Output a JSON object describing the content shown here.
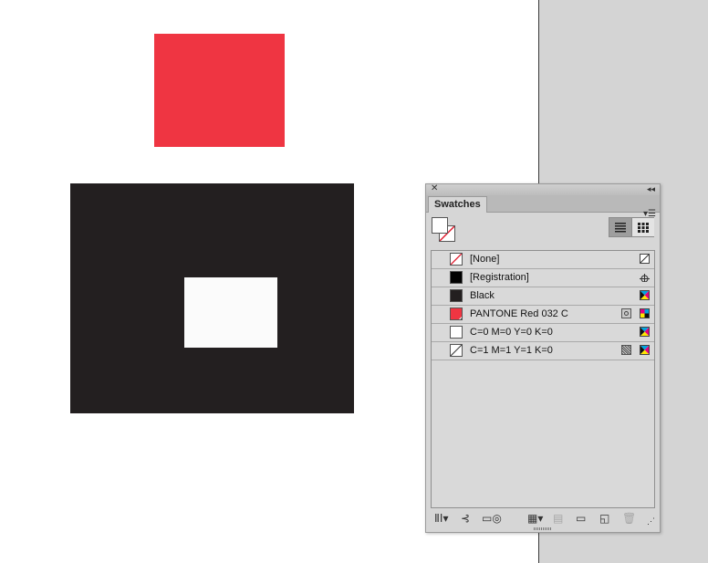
{
  "canvas": {
    "red_color": "#ef3542",
    "black_color": "#231f20",
    "white_color": "#fbfbfb"
  },
  "panel": {
    "close_icon": "close-icon",
    "collapse_icon": "double-chevron-left-icon",
    "tab_label": "Swatches",
    "menu_icon": "panel-menu-icon",
    "view_list_icon": "list-view-icon",
    "view_grid_icon": "grid-view-icon",
    "swatches": [
      {
        "name": "[None]",
        "color": "none",
        "mode_icon": "none-icon"
      },
      {
        "name": "[Registration]",
        "color": "#000000",
        "mode_icon": "registration-icon"
      },
      {
        "name": "Black",
        "color": "#231f20",
        "mode_icon": "cmyk-icon"
      },
      {
        "name": "PANTONE Red 032 C",
        "color": "#ef3542",
        "mode_icon": "cmyk-icon",
        "extra_icon": "spot-color-icon"
      },
      {
        "name": "C=0 M=0 Y=0 K=0",
        "color": "#ffffff",
        "mode_icon": "cmyk-icon"
      },
      {
        "name": "C=1 M=1 Y=1 K=0",
        "color": "#fdfdfd",
        "mode_icon": "cmyk-icon",
        "extra_icon": "process-color-icon"
      }
    ],
    "bottom_icons": [
      "swatch-library-icon",
      "show-all-swatches-icon",
      "show-color-swatches-icon",
      "show-gradient-swatches-icon",
      "new-color-group-icon",
      "new-group-folder-icon",
      "new-swatch-icon",
      "delete-swatch-icon"
    ]
  }
}
